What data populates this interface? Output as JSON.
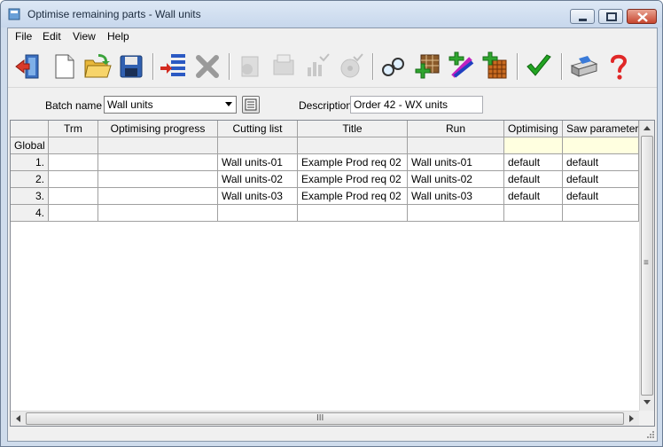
{
  "window": {
    "title": "Optimise remaining parts - Wall units"
  },
  "menu": [
    "File",
    "Edit",
    "View",
    "Help"
  ],
  "toolbar": [
    {
      "name": "exit-icon"
    },
    {
      "name": "new-document-icon"
    },
    {
      "name": "open-folder-icon"
    },
    {
      "name": "save-icon"
    },
    {
      "name": "add-row-icon"
    },
    {
      "name": "delete-icon"
    },
    {
      "name": "optimise-icon"
    },
    {
      "name": "print-list-icon"
    },
    {
      "name": "graph-icon"
    },
    {
      "name": "saw-icon"
    },
    {
      "name": "search-icon"
    },
    {
      "name": "add-board-icon"
    },
    {
      "name": "add-edge-icon"
    },
    {
      "name": "add-pattern-icon"
    },
    {
      "name": "checkmark-icon"
    },
    {
      "name": "print-icon"
    },
    {
      "name": "help-icon"
    }
  ],
  "batch": {
    "label": "Batch name",
    "value": "Wall units"
  },
  "description": {
    "label": "Description",
    "value": "Order 42 - WX units"
  },
  "grid": {
    "headers": [
      "",
      "Trm",
      "Optimising progress",
      "Cutting list",
      "Title",
      "Run",
      "Optimising ...",
      "Saw parameters"
    ],
    "rows": [
      [
        "Global",
        "",
        "",
        "",
        "",
        "",
        "",
        ""
      ],
      [
        "1.",
        "",
        "",
        "Wall units-01",
        "Example Prod req 02",
        "Wall units-01",
        "default",
        "default"
      ],
      [
        "2.",
        "",
        "",
        "Wall units-02",
        "Example Prod req 02",
        "Wall units-02",
        "default",
        "default"
      ],
      [
        "3.",
        "",
        "",
        "Wall units-03",
        "Example Prod req 02",
        "Wall units-03",
        "default",
        "default"
      ],
      [
        "4.",
        "",
        "",
        "",
        "",
        "",
        "",
        ""
      ]
    ]
  },
  "scrollbar": {
    "h_grip": "III",
    "v_grip": "≡"
  }
}
